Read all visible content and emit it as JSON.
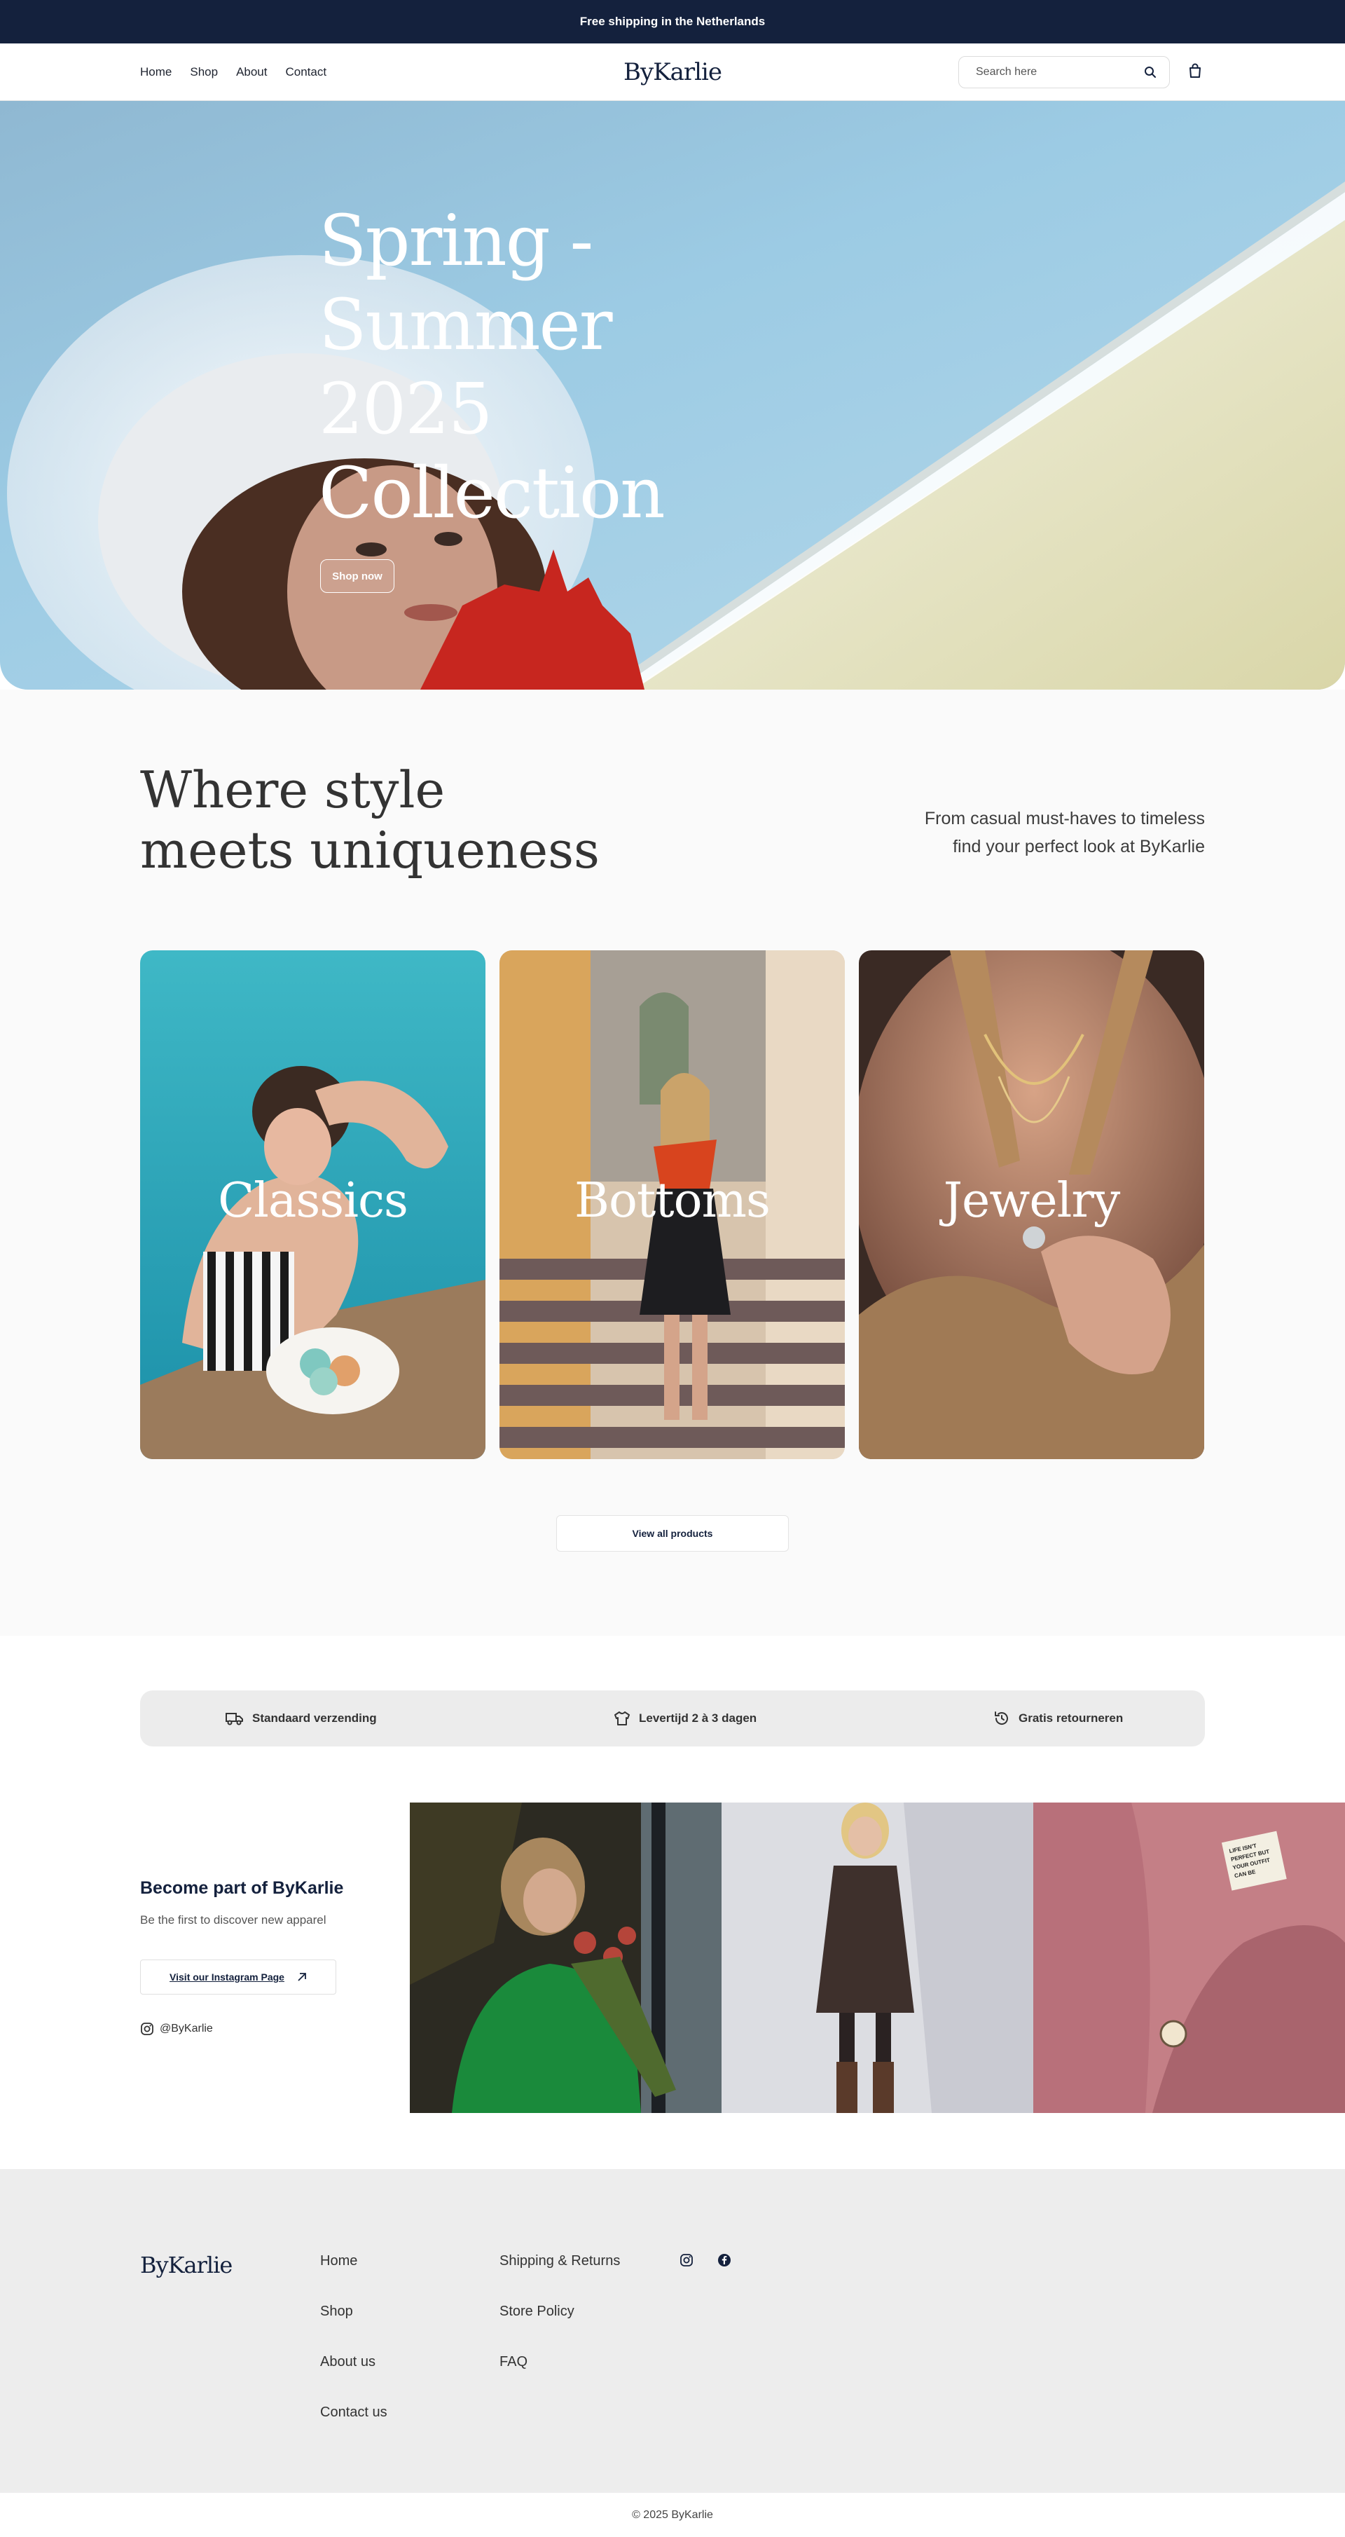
{
  "announcement": "Free shipping in the Netherlands",
  "nav": {
    "links": [
      "Home",
      "Shop",
      "About",
      "Contact"
    ],
    "logo": "ByKarlie",
    "search_placeholder": "Search here"
  },
  "hero": {
    "title": "Spring - Summer 2025 Collection",
    "button": "Shop now"
  },
  "collection": {
    "title_lines": [
      "Where style",
      "meets uniqueness"
    ],
    "subtitle_lines": [
      "From casual must-haves to timeless",
      "find your perfect look at ByKarlie"
    ],
    "categories": [
      "Classics",
      "Bottoms",
      "Jewelry"
    ],
    "view_all": "View all products"
  },
  "features": [
    {
      "icon": "truck-icon",
      "label": "Standaard verzending"
    },
    {
      "icon": "shirt-icon",
      "label": "Levertijd 2 à 3 dagen"
    },
    {
      "icon": "return-icon",
      "label": "Gratis retourneren"
    }
  ],
  "instagram": {
    "title": "Become part of ByKarlie",
    "subtitle": "Be the first to discover new apparel",
    "button": "Visit our Instagram Page",
    "handle": "@ByKarlie",
    "label_text": "LIFE ISN'T PERFECT BUT YOUR OUTFIT CAN BE"
  },
  "footer": {
    "logo": "ByKarlie",
    "col1": [
      "Home",
      "Shop",
      "About us",
      "Contact us"
    ],
    "col2": [
      "Shipping & Returns",
      "Store Policy",
      "FAQ"
    ],
    "social": [
      "instagram-icon",
      "facebook-icon"
    ],
    "copyright": "© 2025 ByKarlie"
  },
  "colors": {
    "navy": "#14213d",
    "page_bg": "#fafafa",
    "panel_gray": "#ececec"
  }
}
